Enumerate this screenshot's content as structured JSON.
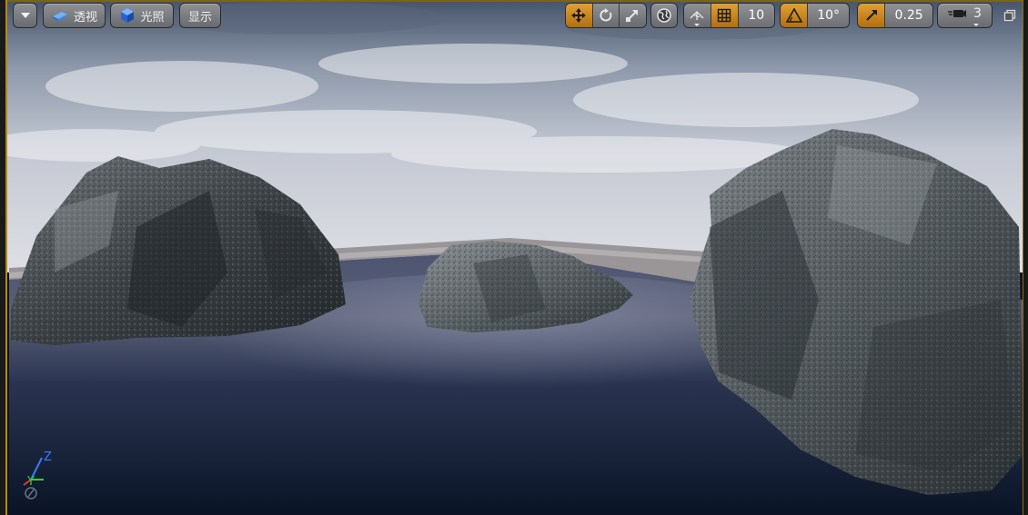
{
  "toolbar_left": {
    "menu_icon": "chevron-down-icon",
    "perspective_label": "透视",
    "perspective_icon": "perspective-cube-icon",
    "lighting_label": "光照",
    "lighting_icon": "lit-sphere-icon",
    "show_label": "显示"
  },
  "toolbar_right": {
    "transform_icons": [
      "move-icon",
      "rotate-icon",
      "scale-icon"
    ],
    "world_local_icon": "globe-icon",
    "surface_snap_icon": "surface-snap-icon",
    "grid_snap_icon": "grid-icon",
    "grid_snap_value": "10",
    "rotation_snap_icon": "angle-icon",
    "rotation_snap_value": "10°",
    "scale_snap_icon": "scale-snap-icon",
    "scale_snap_value": "0.25",
    "camera_speed_icon": "camera-speed-icon",
    "camera_speed_value": "3",
    "maximize_icon": "restore-viewport-icon"
  },
  "axis_indicator": {
    "z_label": "Z",
    "y_label": "Y"
  },
  "colors": {
    "active": "#d48a1e",
    "button": "#7c7f83",
    "frame": "#b38a14"
  }
}
